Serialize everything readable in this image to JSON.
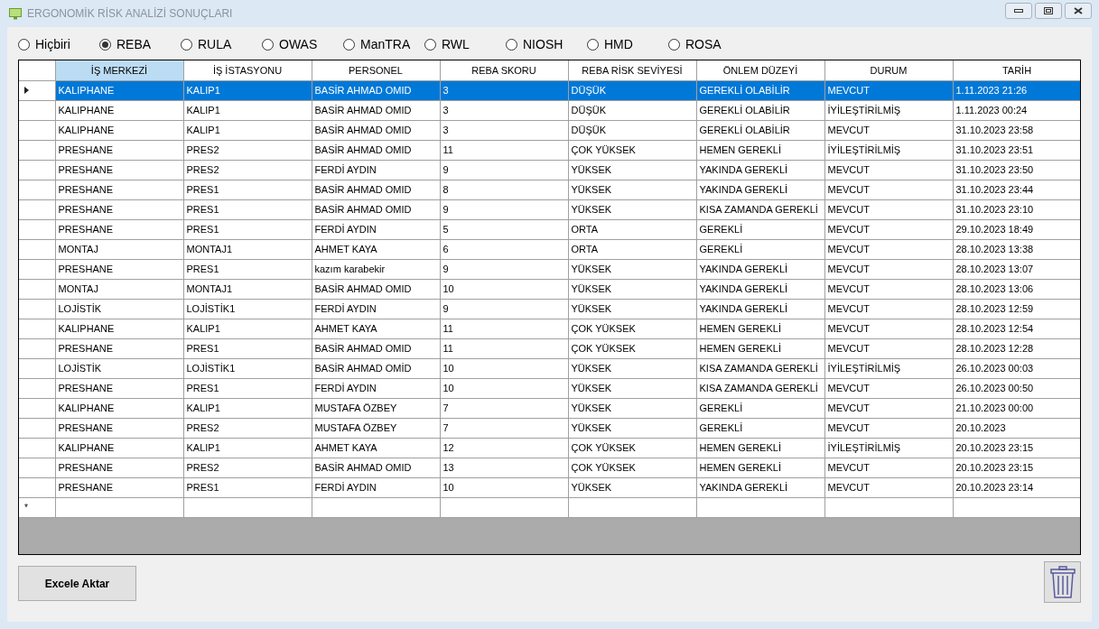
{
  "window": {
    "title": "ERGONOMİK RİSK ANALİZİ SONUÇLARI"
  },
  "methods": [
    {
      "label": "Hiçbiri",
      "selected": false
    },
    {
      "label": "REBA",
      "selected": true
    },
    {
      "label": "RULA",
      "selected": false
    },
    {
      "label": "OWAS",
      "selected": false
    },
    {
      "label": "ManTRA",
      "selected": false
    },
    {
      "label": "RWL",
      "selected": false
    },
    {
      "label": "NIOSH",
      "selected": false
    },
    {
      "label": "HMD",
      "selected": false
    },
    {
      "label": "ROSA",
      "selected": false
    }
  ],
  "table": {
    "columns": [
      {
        "label": "İŞ MERKEZİ",
        "selected": true
      },
      {
        "label": "İŞ İSTASYONU",
        "selected": false
      },
      {
        "label": "PERSONEL",
        "selected": false
      },
      {
        "label": "REBA SKORU",
        "selected": false
      },
      {
        "label": "REBA RİSK SEVİYESİ",
        "selected": false
      },
      {
        "label": "ÖNLEM DÜZEYİ",
        "selected": false
      },
      {
        "label": "DURUM",
        "selected": false
      },
      {
        "label": "TARİH",
        "selected": false
      }
    ],
    "rows": [
      {
        "selected": true,
        "cells": [
          "KALIPHANE",
          "KALIP1",
          "BASİR AHMAD OMID",
          "3",
          "DÜŞÜK",
          "GEREKLİ OLABİLİR",
          "MEVCUT",
          "1.11.2023 21:26"
        ]
      },
      {
        "selected": false,
        "cells": [
          "KALIPHANE",
          "KALIP1",
          "BASİR AHMAD OMID",
          "3",
          "DÜŞÜK",
          "GEREKLİ OLABİLİR",
          "İYİLEŞTİRİLMİŞ",
          "1.11.2023 00:24"
        ]
      },
      {
        "selected": false,
        "cells": [
          "KALIPHANE",
          "KALIP1",
          "BASİR AHMAD OMID",
          "3",
          "DÜŞÜK",
          "GEREKLİ OLABİLİR",
          "MEVCUT",
          "31.10.2023 23:58"
        ]
      },
      {
        "selected": false,
        "cells": [
          "PRESHANE",
          "PRES2",
          "BASİR AHMAD OMID",
          "11",
          "ÇOK YÜKSEK",
          "HEMEN GEREKLİ",
          "İYİLEŞTİRİLMİŞ",
          "31.10.2023 23:51"
        ]
      },
      {
        "selected": false,
        "cells": [
          "PRESHANE",
          "PRES2",
          "FERDİ AYDIN",
          "9",
          "YÜKSEK",
          "YAKINDA GEREKLİ",
          "MEVCUT",
          "31.10.2023 23:50"
        ]
      },
      {
        "selected": false,
        "cells": [
          "PRESHANE",
          "PRES1",
          "BASİR AHMAD OMID",
          "8",
          "YÜKSEK",
          "YAKINDA GEREKLİ",
          "MEVCUT",
          "31.10.2023 23:44"
        ]
      },
      {
        "selected": false,
        "cells": [
          "PRESHANE",
          "PRES1",
          "BASİR AHMAD OMID",
          "9",
          "YÜKSEK",
          "KISA ZAMANDA GEREKLİ",
          "MEVCUT",
          "31.10.2023 23:10"
        ]
      },
      {
        "selected": false,
        "cells": [
          "PRESHANE",
          "PRES1",
          "FERDİ AYDIN",
          "5",
          "ORTA",
          "GEREKLİ",
          "MEVCUT",
          "29.10.2023 18:49"
        ]
      },
      {
        "selected": false,
        "cells": [
          "MONTAJ",
          "MONTAJ1",
          "AHMET KAYA",
          "6",
          "ORTA",
          "GEREKLİ",
          "MEVCUT",
          "28.10.2023 13:38"
        ]
      },
      {
        "selected": false,
        "cells": [
          "PRESHANE",
          "PRES1",
          "kazım karabekir",
          "9",
          "YÜKSEK",
          "YAKINDA GEREKLİ",
          "MEVCUT",
          "28.10.2023 13:07"
        ]
      },
      {
        "selected": false,
        "cells": [
          "MONTAJ",
          "MONTAJ1",
          "BASİR AHMAD OMID",
          "10",
          "YÜKSEK",
          "YAKINDA GEREKLİ",
          "MEVCUT",
          "28.10.2023 13:06"
        ]
      },
      {
        "selected": false,
        "cells": [
          "LOJİSTİK",
          "LOJİSTİK1",
          "FERDİ AYDIN",
          "9",
          "YÜKSEK",
          "YAKINDA GEREKLİ",
          "MEVCUT",
          "28.10.2023 12:59"
        ]
      },
      {
        "selected": false,
        "cells": [
          "KALIPHANE",
          "KALIP1",
          "AHMET KAYA",
          "11",
          "ÇOK YÜKSEK",
          "HEMEN GEREKLİ",
          "MEVCUT",
          "28.10.2023 12:54"
        ]
      },
      {
        "selected": false,
        "cells": [
          "PRESHANE",
          "PRES1",
          "BASİR AHMAD OMID",
          "11",
          "ÇOK YÜKSEK",
          "HEMEN GEREKLİ",
          "MEVCUT",
          "28.10.2023 12:28"
        ]
      },
      {
        "selected": false,
        "cells": [
          "LOJİSTİK",
          "LOJİSTİK1",
          "BASİR AHMAD OMİD",
          "10",
          "YÜKSEK",
          "KISA ZAMANDA GEREKLİ",
          "İYİLEŞTİRİLMİŞ",
          "26.10.2023 00:03"
        ]
      },
      {
        "selected": false,
        "cells": [
          "PRESHANE",
          "PRES1",
          "FERDİ AYDIN",
          "10",
          "YÜKSEK",
          "KISA ZAMANDA GEREKLİ",
          "MEVCUT",
          "26.10.2023 00:50"
        ]
      },
      {
        "selected": false,
        "cells": [
          "KALIPHANE",
          "KALIP1",
          "MUSTAFA ÖZBEY",
          "7",
          "YÜKSEK",
          "GEREKLİ",
          "MEVCUT",
          "21.10.2023 00:00"
        ]
      },
      {
        "selected": false,
        "cells": [
          "PRESHANE",
          "PRES2",
          "MUSTAFA ÖZBEY",
          "7",
          "YÜKSEK",
          "GEREKLİ",
          "MEVCUT",
          "20.10.2023"
        ]
      },
      {
        "selected": false,
        "cells": [
          "KALIPHANE",
          "KALIP1",
          "AHMET KAYA",
          "12",
          "ÇOK YÜKSEK",
          "HEMEN GEREKLİ",
          "İYİLEŞTİRİLMİŞ",
          "20.10.2023 23:15"
        ]
      },
      {
        "selected": false,
        "cells": [
          "PRESHANE",
          "PRES2",
          "BASİR AHMAD OMID",
          "13",
          "ÇOK YÜKSEK",
          "HEMEN GEREKLİ",
          "MEVCUT",
          "20.10.2023 23:15"
        ]
      },
      {
        "selected": false,
        "cells": [
          "PRESHANE",
          "PRES1",
          "FERDİ AYDIN",
          "10",
          "YÜKSEK",
          "YAKINDA GEREKLİ",
          "MEVCUT",
          "20.10.2023 23:14"
        ]
      }
    ],
    "new_row_marker": "*"
  },
  "buttons": {
    "export": "Excele Aktar"
  }
}
